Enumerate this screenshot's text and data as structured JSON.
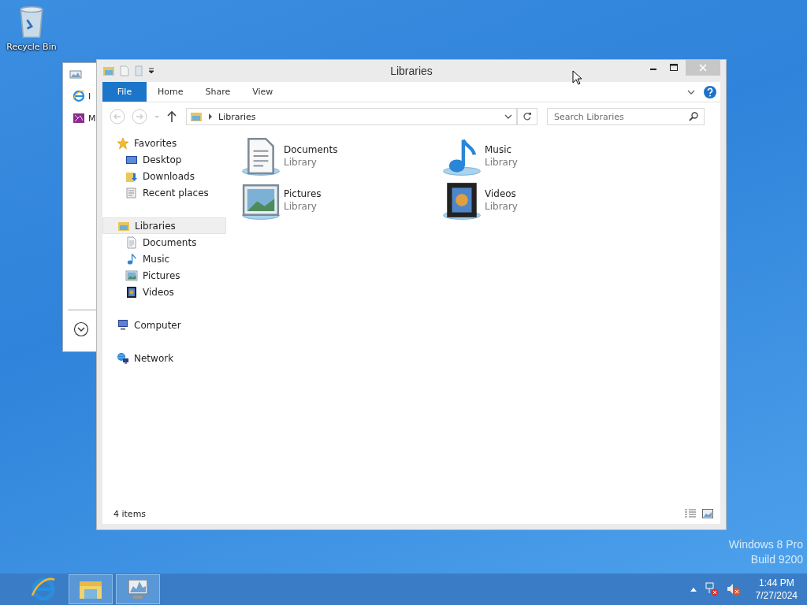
{
  "desktop": {
    "icons": [
      {
        "label": "Recycle Bin",
        "kind": "recycle"
      }
    ],
    "watermark": [
      "Windows 8 Pro",
      "Build 9200"
    ]
  },
  "background_window": {
    "items": [
      {
        "label": "I",
        "kind": "ie"
      },
      {
        "label": "M",
        "kind": "movie"
      }
    ]
  },
  "window": {
    "title": "Libraries",
    "ribbon_tabs": [
      {
        "label": "File",
        "kind": "file"
      },
      {
        "label": "Home",
        "kind": "tab"
      },
      {
        "label": "Share",
        "kind": "tab"
      },
      {
        "label": "View",
        "kind": "tab"
      }
    ],
    "address": {
      "path": [
        "Libraries"
      ]
    },
    "search": {
      "placeholder": "Search Libraries"
    },
    "navigation": [
      {
        "label": "Favorites",
        "kind": "star",
        "selected": false,
        "children": [
          {
            "label": "Desktop",
            "kind": "desktop",
            "selected": false
          },
          {
            "label": "Downloads",
            "kind": "downloads",
            "selected": false
          },
          {
            "label": "Recent places",
            "kind": "recent",
            "selected": false
          }
        ]
      },
      {
        "label": "Libraries",
        "kind": "libraries",
        "selected": true,
        "children": [
          {
            "label": "Documents",
            "kind": "documents",
            "selected": false
          },
          {
            "label": "Music",
            "kind": "music",
            "selected": false
          },
          {
            "label": "Pictures",
            "kind": "pictures",
            "selected": false
          },
          {
            "label": "Videos",
            "kind": "videos",
            "selected": false
          }
        ]
      },
      {
        "label": "Computer",
        "kind": "computer",
        "selected": false
      },
      {
        "label": "Network",
        "kind": "network",
        "selected": false
      }
    ],
    "items": [
      {
        "name": "Documents",
        "type": "Library",
        "kind": "documents"
      },
      {
        "name": "Music",
        "type": "Library",
        "kind": "music"
      },
      {
        "name": "Pictures",
        "type": "Library",
        "kind": "pictures"
      },
      {
        "name": "Videos",
        "type": "Library",
        "kind": "videos"
      }
    ],
    "status_bar": "4 items"
  },
  "taskbar": {
    "apps": [
      {
        "kind": "ie",
        "active": false
      },
      {
        "kind": "explorer",
        "active": true
      },
      {
        "kind": "monitor",
        "active": true
      }
    ],
    "clock": {
      "time": "1:44 PM",
      "date": "7/27/2024"
    }
  }
}
